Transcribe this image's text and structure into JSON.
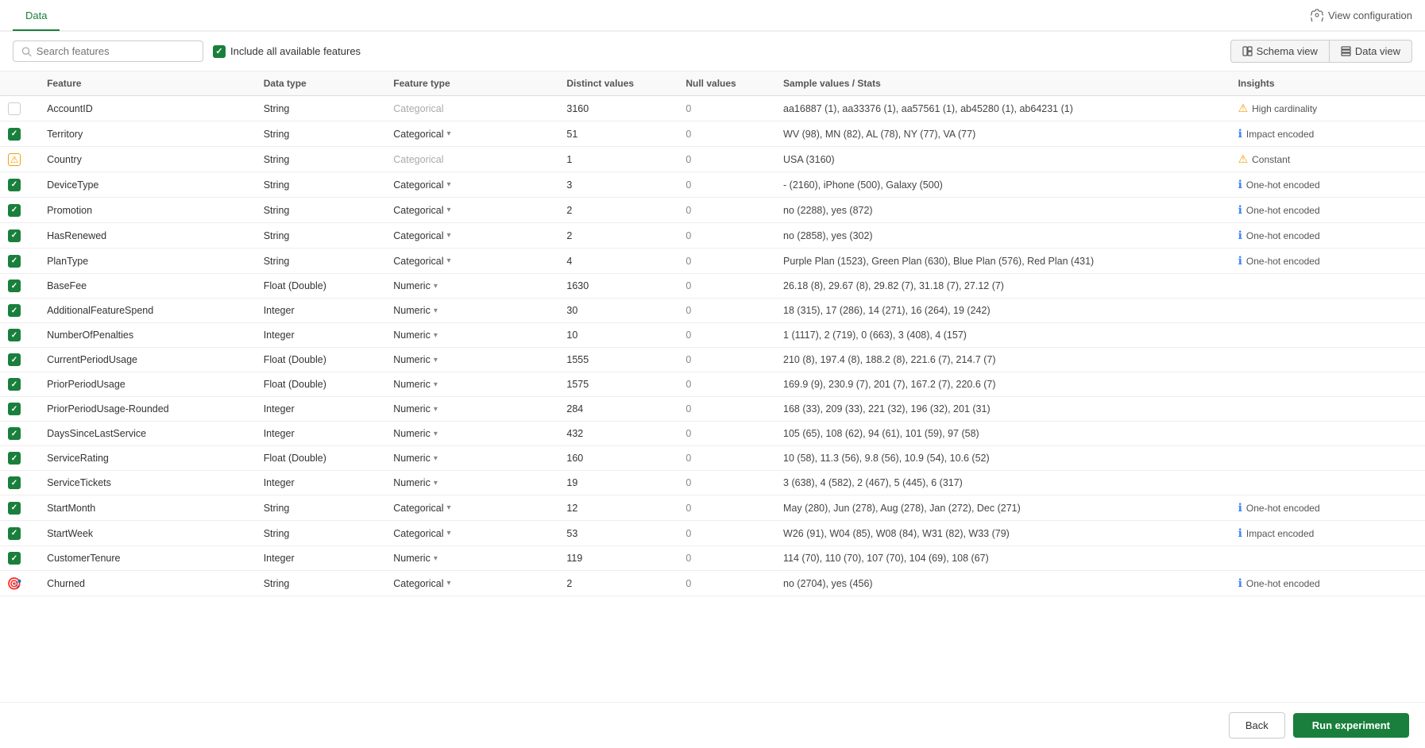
{
  "nav": {
    "active_tab": "Data",
    "view_config_label": "View configuration"
  },
  "toolbar": {
    "search_placeholder": "Search features",
    "include_all_label": "Include all available features",
    "schema_view_label": "Schema view",
    "data_view_label": "Data view"
  },
  "table": {
    "headers": [
      "",
      "Feature",
      "Data type",
      "Feature type",
      "Distinct values",
      "Null values",
      "Sample values / Stats",
      "Insights"
    ],
    "rows": [
      {
        "checked": "unchecked",
        "feature": "AccountID",
        "datatype": "String",
        "featuretype": "Categorical",
        "featuretype_active": false,
        "distinct": "3160",
        "nulls": "0",
        "sample": "aa16887 (1), aa33376 (1), aa57561 (1), ab45280 (1), ab64231 (1)",
        "insight_type": "warn",
        "insight_text": "High cardinality"
      },
      {
        "checked": "checked",
        "feature": "Territory",
        "datatype": "String",
        "featuretype": "Categorical",
        "featuretype_active": true,
        "distinct": "51",
        "nulls": "0",
        "sample": "WV (98), MN (82), AL (78), NY (77), VA (77)",
        "insight_type": "info",
        "insight_text": "Impact encoded"
      },
      {
        "checked": "warn",
        "feature": "Country",
        "datatype": "String",
        "featuretype": "Categorical",
        "featuretype_active": false,
        "distinct": "1",
        "nulls": "0",
        "sample": "USA (3160)",
        "insight_type": "warn",
        "insight_text": "Constant"
      },
      {
        "checked": "checked",
        "feature": "DeviceType",
        "datatype": "String",
        "featuretype": "Categorical",
        "featuretype_active": true,
        "distinct": "3",
        "nulls": "0",
        "sample": "- (2160), iPhone (500), Galaxy (500)",
        "insight_type": "info",
        "insight_text": "One-hot encoded"
      },
      {
        "checked": "checked",
        "feature": "Promotion",
        "datatype": "String",
        "featuretype": "Categorical",
        "featuretype_active": true,
        "distinct": "2",
        "nulls": "0",
        "sample": "no (2288), yes (872)",
        "insight_type": "info",
        "insight_text": "One-hot encoded"
      },
      {
        "checked": "checked",
        "feature": "HasRenewed",
        "datatype": "String",
        "featuretype": "Categorical",
        "featuretype_active": true,
        "distinct": "2",
        "nulls": "0",
        "sample": "no (2858), yes (302)",
        "insight_type": "info",
        "insight_text": "One-hot encoded"
      },
      {
        "checked": "checked",
        "feature": "PlanType",
        "datatype": "String",
        "featuretype": "Categorical",
        "featuretype_active": true,
        "distinct": "4",
        "nulls": "0",
        "sample": "Purple Plan (1523), Green Plan (630), Blue Plan (576), Red Plan (431)",
        "insight_type": "info",
        "insight_text": "One-hot encoded"
      },
      {
        "checked": "checked",
        "feature": "BaseFee",
        "datatype": "Float (Double)",
        "featuretype": "Numeric",
        "featuretype_active": true,
        "distinct": "1630",
        "nulls": "0",
        "sample": "26.18 (8), 29.67 (8), 29.82 (7), 31.18 (7), 27.12 (7)",
        "insight_type": "none",
        "insight_text": ""
      },
      {
        "checked": "checked",
        "feature": "AdditionalFeatureSpend",
        "datatype": "Integer",
        "featuretype": "Numeric",
        "featuretype_active": true,
        "distinct": "30",
        "nulls": "0",
        "sample": "18 (315), 17 (286), 14 (271), 16 (264), 19 (242)",
        "insight_type": "none",
        "insight_text": ""
      },
      {
        "checked": "checked",
        "feature": "NumberOfPenalties",
        "datatype": "Integer",
        "featuretype": "Numeric",
        "featuretype_active": true,
        "distinct": "10",
        "nulls": "0",
        "sample": "1 (1117), 2 (719), 0 (663), 3 (408), 4 (157)",
        "insight_type": "none",
        "insight_text": ""
      },
      {
        "checked": "checked",
        "feature": "CurrentPeriodUsage",
        "datatype": "Float (Double)",
        "featuretype": "Numeric",
        "featuretype_active": true,
        "distinct": "1555",
        "nulls": "0",
        "sample": "210 (8), 197.4 (8), 188.2 (8), 221.6 (7), 214.7 (7)",
        "insight_type": "none",
        "insight_text": ""
      },
      {
        "checked": "checked",
        "feature": "PriorPeriodUsage",
        "datatype": "Float (Double)",
        "featuretype": "Numeric",
        "featuretype_active": true,
        "distinct": "1575",
        "nulls": "0",
        "sample": "169.9 (9), 230.9 (7), 201 (7), 167.2 (7), 220.6 (7)",
        "insight_type": "none",
        "insight_text": ""
      },
      {
        "checked": "checked",
        "feature": "PriorPeriodUsage-Rounded",
        "datatype": "Integer",
        "featuretype": "Numeric",
        "featuretype_active": true,
        "distinct": "284",
        "nulls": "0",
        "sample": "168 (33), 209 (33), 221 (32), 196 (32), 201 (31)",
        "insight_type": "none",
        "insight_text": ""
      },
      {
        "checked": "checked",
        "feature": "DaysSinceLastService",
        "datatype": "Integer",
        "featuretype": "Numeric",
        "featuretype_active": true,
        "distinct": "432",
        "nulls": "0",
        "sample": "105 (65), 108 (62), 94 (61), 101 (59), 97 (58)",
        "insight_type": "none",
        "insight_text": ""
      },
      {
        "checked": "checked",
        "feature": "ServiceRating",
        "datatype": "Float (Double)",
        "featuretype": "Numeric",
        "featuretype_active": true,
        "distinct": "160",
        "nulls": "0",
        "sample": "10 (58), 11.3 (56), 9.8 (56), 10.9 (54), 10.6 (52)",
        "insight_type": "none",
        "insight_text": ""
      },
      {
        "checked": "checked",
        "feature": "ServiceTickets",
        "datatype": "Integer",
        "featuretype": "Numeric",
        "featuretype_active": true,
        "distinct": "19",
        "nulls": "0",
        "sample": "3 (638), 4 (582), 2 (467), 5 (445), 6 (317)",
        "insight_type": "none",
        "insight_text": ""
      },
      {
        "checked": "checked",
        "feature": "StartMonth",
        "datatype": "String",
        "featuretype": "Categorical",
        "featuretype_active": true,
        "distinct": "12",
        "nulls": "0",
        "sample": "May (280), Jun (278), Aug (278), Jan (272), Dec (271)",
        "insight_type": "info",
        "insight_text": "One-hot encoded"
      },
      {
        "checked": "checked",
        "feature": "StartWeek",
        "datatype": "String",
        "featuretype": "Categorical",
        "featuretype_active": true,
        "distinct": "53",
        "nulls": "0",
        "sample": "W26 (91), W04 (85), W08 (84), W31 (82), W33 (79)",
        "insight_type": "info",
        "insight_text": "Impact encoded"
      },
      {
        "checked": "checked",
        "feature": "CustomerTenure",
        "datatype": "Integer",
        "featuretype": "Numeric",
        "featuretype_active": true,
        "distinct": "119",
        "nulls": "0",
        "sample": "114 (70), 110 (70), 107 (70), 104 (69), 108 (67)",
        "insight_type": "none",
        "insight_text": ""
      },
      {
        "checked": "target",
        "feature": "Churned",
        "datatype": "String",
        "featuretype": "Categorical",
        "featuretype_active": true,
        "distinct": "2",
        "nulls": "0",
        "sample": "no (2704), yes (456)",
        "insight_type": "info",
        "insight_text": "One-hot encoded"
      }
    ]
  },
  "footer": {
    "back_label": "Back",
    "run_label": "Run experiment"
  }
}
